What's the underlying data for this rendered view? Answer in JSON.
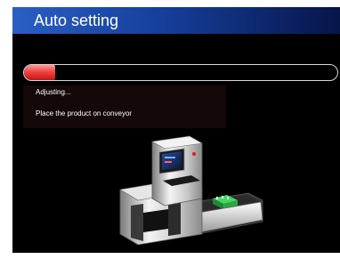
{
  "window": {
    "title": "Auto setting"
  },
  "progress": {
    "value_fraction": 0.1,
    "status_text": "Adjusting...",
    "instruction_text": "Place the product on conveyor"
  },
  "illustration": {
    "name": "inspection-machine-illustration"
  },
  "colors": {
    "title_bar": "#1f4fb5",
    "background": "#000000",
    "progress_fill": "#e23030",
    "product": "#2bb54a"
  }
}
